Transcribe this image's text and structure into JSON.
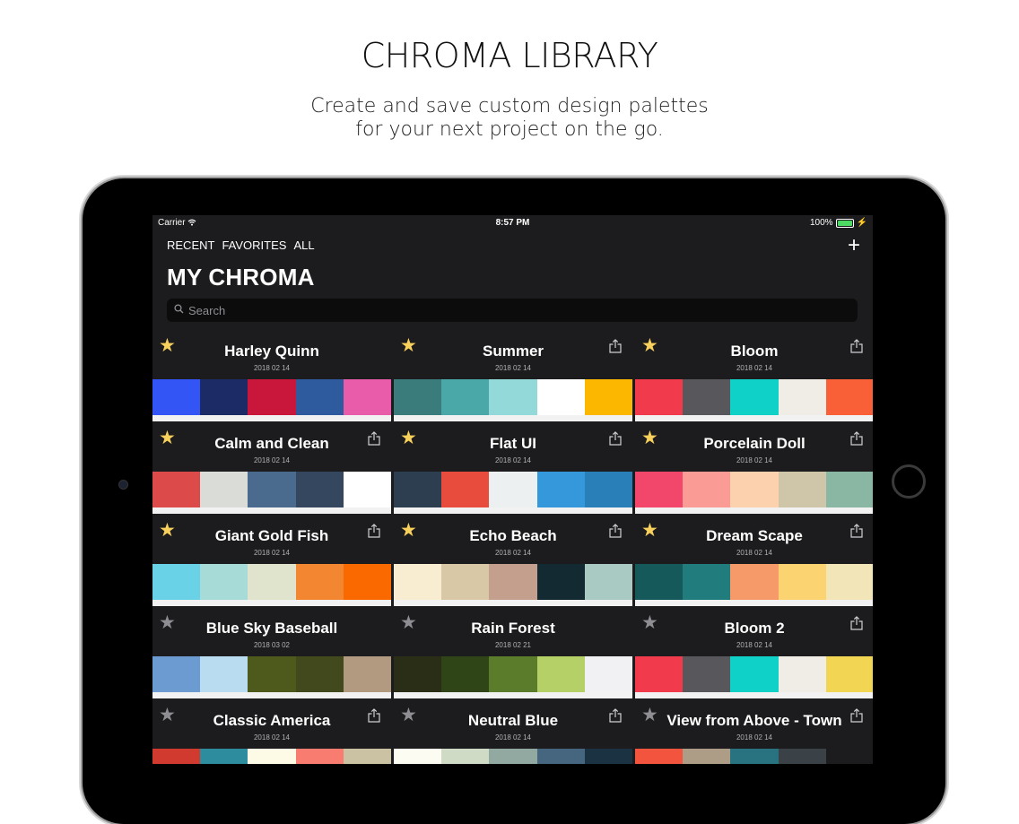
{
  "promo": {
    "headline": "CHROMA LIBRARY",
    "sub1": "Create and save custom design palettes",
    "sub2": "for your next project on the go."
  },
  "status": {
    "carrier": "Carrier",
    "time": "8:57 PM",
    "battery": "100%"
  },
  "nav": {
    "recent": "RECENT",
    "favorites": "FAVORITES",
    "all": "ALL",
    "add": "+"
  },
  "title": "MY CHROMA",
  "search": {
    "placeholder": "Search"
  },
  "palettes": [
    {
      "name": "Harley Quinn",
      "date": "2018 02 14",
      "favorite": true,
      "share": false,
      "colors": [
        "#3355f5",
        "#1c2a66",
        "#c8173a",
        "#2e5b9e",
        "#e95ca9"
      ]
    },
    {
      "name": "Summer",
      "date": "2018 02 14",
      "favorite": true,
      "share": true,
      "colors": [
        "#3a7b7b",
        "#4ba8a8",
        "#94d9da",
        "#ffffff",
        "#fcb700"
      ]
    },
    {
      "name": "Bloom",
      "date": "2018 02 14",
      "favorite": true,
      "share": true,
      "colors": [
        "#f23a4d",
        "#58575c",
        "#10d1c8",
        "#efede6",
        "#fa6038"
      ]
    },
    {
      "name": "Calm and Clean",
      "date": "2018 02 14",
      "favorite": true,
      "share": true,
      "colors": [
        "#dc4a4a",
        "#dadcd7",
        "#4a6a8e",
        "#34475f",
        "#ffffff"
      ]
    },
    {
      "name": "Flat UI",
      "date": "2018 02 14",
      "favorite": true,
      "share": true,
      "colors": [
        "#2c3e50",
        "#e74c3c",
        "#ecf0f1",
        "#3498db",
        "#2980b9"
      ]
    },
    {
      "name": "Porcelain Doll",
      "date": "2018 02 14",
      "favorite": true,
      "share": true,
      "colors": [
        "#f2476a",
        "#fb9b95",
        "#fcd1ae",
        "#cfc6a9",
        "#8ab7a3"
      ]
    },
    {
      "name": "Giant Gold Fish",
      "date": "2018 02 14",
      "favorite": true,
      "share": true,
      "colors": [
        "#69d2e7",
        "#a7dbd8",
        "#e0e4cc",
        "#f38630",
        "#fa6900"
      ]
    },
    {
      "name": "Echo Beach",
      "date": "2018 02 14",
      "favorite": true,
      "share": true,
      "colors": [
        "#f8edd1",
        "#d8c8a6",
        "#c49f8e",
        "#132a32",
        "#a9c9c3"
      ]
    },
    {
      "name": "Dream Scape",
      "date": "2018 02 14",
      "favorite": true,
      "share": true,
      "colors": [
        "#15595a",
        "#217c7e",
        "#f59a68",
        "#fbd471",
        "#f2e6b8"
      ]
    },
    {
      "name": "Blue Sky Baseball",
      "date": "2018 03 02",
      "favorite": false,
      "share": false,
      "colors": [
        "#6b9bd1",
        "#b9dcf0",
        "#4e5a1c",
        "#424a1d",
        "#b29a80"
      ]
    },
    {
      "name": "Rain Forest",
      "date": "2018 02 21",
      "favorite": false,
      "share": false,
      "colors": [
        "#2a2e16",
        "#2f4517",
        "#5b7c2b",
        "#b4d066",
        "#f1f1f3"
      ]
    },
    {
      "name": "Bloom 2",
      "date": "2018 02 14",
      "favorite": false,
      "share": true,
      "colors": [
        "#f23a4d",
        "#58575c",
        "#10d1c8",
        "#efede6",
        "#f2d553"
      ]
    },
    {
      "name": "Classic America",
      "date": "2018 02 14",
      "favorite": false,
      "share": true,
      "colors": [
        "#d13b2f",
        "#2d8c9e",
        "#fdfbe6",
        "#f87c70",
        "#cbc2a3"
      ]
    },
    {
      "name": "Neutral Blue",
      "date": "2018 02 14",
      "favorite": false,
      "share": true,
      "colors": [
        "#fcfcf2",
        "#d0dbc5",
        "#91a9a0",
        "#45667e",
        "#1b3242"
      ]
    },
    {
      "name": "View from Above - Town",
      "date": "2018 02 14",
      "favorite": false,
      "share": true,
      "colors": [
        "#f2543d",
        "#ad9c86",
        "#297280",
        "#3a4248",
        "#1c1c1e"
      ]
    }
  ],
  "icons": {
    "star": "star-icon",
    "share": "share-icon",
    "search": "search-icon",
    "add": "plus-icon",
    "wifi": "wifi-icon",
    "battery": "battery-icon"
  },
  "colors": {
    "favorite": "#f8d15c",
    "background": "#1c1c1e",
    "accent_battery": "#4cd964"
  }
}
